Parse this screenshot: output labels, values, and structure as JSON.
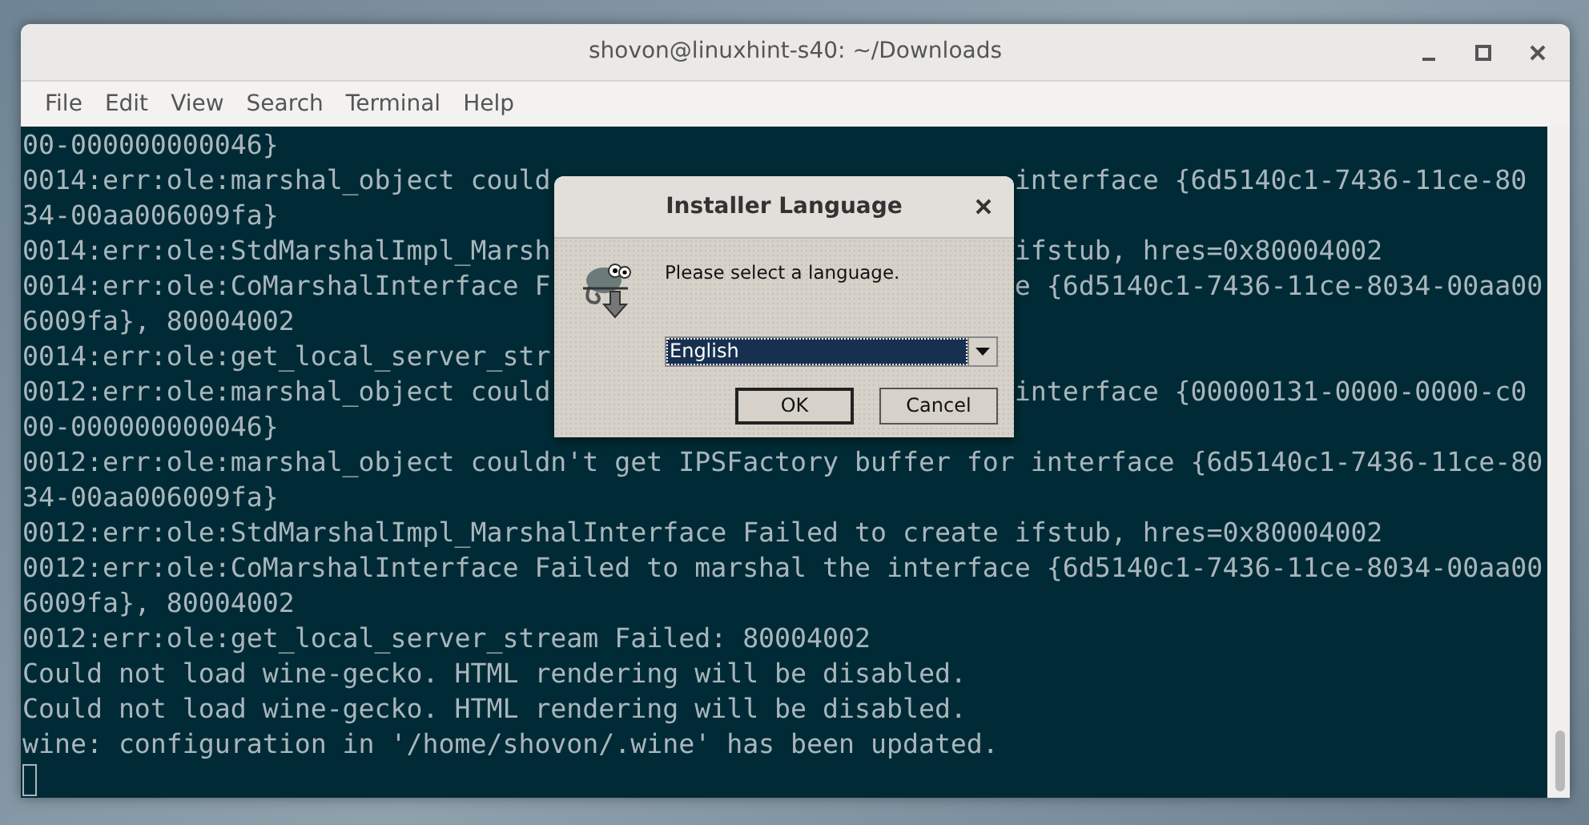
{
  "window": {
    "title": "shovon@linuxhint-s40: ~/Downloads"
  },
  "menu": [
    "File",
    "Edit",
    "View",
    "Search",
    "Terminal",
    "Help"
  ],
  "terminal": {
    "lines": [
      {
        "left": "00-000000000046}"
      },
      {
        "left": "0014:err:ole:marshal_object could",
        "right": "interface {6d5140c1-7436-11ce-80"
      },
      {
        "left": "34-00aa006009fa}"
      },
      {
        "left": "0014:err:ole:StdMarshalImpl_Marsh",
        "right": "ifstub, hres=0x80004002"
      },
      {
        "left": "0014:err:ole:CoMarshalInterface F",
        "right": "e {6d5140c1-7436-11ce-8034-00aa00"
      },
      {
        "left": "6009fa}, 80004002"
      },
      {
        "left": "0014:err:ole:get_local_server_str"
      },
      {
        "left": "0012:err:ole:marshal_object could",
        "right": "interface {00000131-0000-0000-c0"
      },
      {
        "left": "00-000000000046}"
      },
      {
        "left": "0012:err:ole:marshal_object couldn't get IPSFactory buffer for interface {6d5140c1-7436-11ce-80"
      },
      {
        "left": "34-00aa006009fa}"
      },
      {
        "left": "0012:err:ole:StdMarshalImpl_MarshalInterface Failed to create ifstub, hres=0x80004002"
      },
      {
        "left": "0012:err:ole:CoMarshalInterface Failed to marshal the interface {6d5140c1-7436-11ce-8034-00aa00"
      },
      {
        "left": "6009fa}, 80004002"
      },
      {
        "left": "0012:err:ole:get_local_server_stream Failed: 80004002"
      },
      {
        "left": "Could not load wine-gecko. HTML rendering will be disabled."
      },
      {
        "left": "Could not load wine-gecko. HTML rendering will be disabled."
      },
      {
        "left": "wine: configuration in '/home/shovon/.wine' has been updated."
      }
    ]
  },
  "dialog": {
    "title": "Installer Language",
    "message": "Please select a language.",
    "language": "English",
    "buttons": [
      "OK",
      "Cancel"
    ]
  }
}
